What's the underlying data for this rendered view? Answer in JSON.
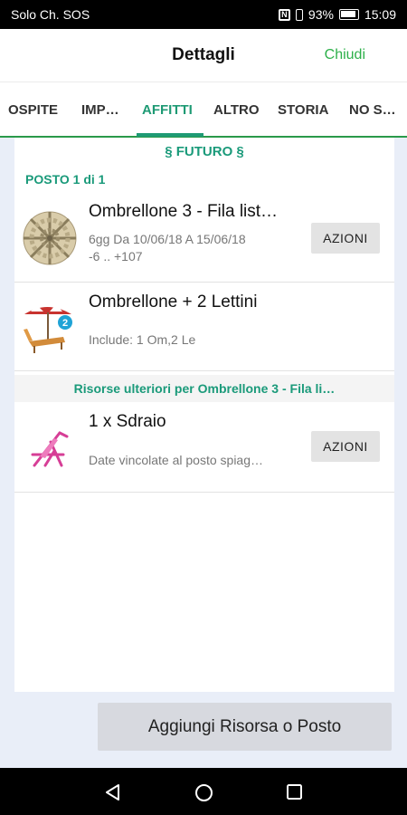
{
  "status_bar": {
    "carrier": "Solo Ch. SOS",
    "battery": "93%",
    "time": "15:09"
  },
  "header": {
    "title": "Dettagli",
    "close_label": "Chiudi"
  },
  "tabs": [
    {
      "label": "OSPITE"
    },
    {
      "label": "IMP…"
    },
    {
      "label": "AFFITTI"
    },
    {
      "label": "ALTRO"
    },
    {
      "label": "STORIA"
    },
    {
      "label": "NO S…"
    }
  ],
  "active_tab": "AFFITTI",
  "main": {
    "section_title": "§  FUTURO  §",
    "posto_label": "POSTO 1 di 1",
    "items": [
      {
        "name": "Ombrellone 3 - Fila list…",
        "details": [
          "6gg  Da 10/06/18 A 15/06/18",
          "-6 .. +107"
        ],
        "action_label": "AZIONI",
        "icon": "umbrella-top-icon"
      },
      {
        "name": "Ombrellone + 2 Lettini",
        "details": [
          "Include: 1 Om,2 Le"
        ],
        "badge": "2",
        "icon": "umbrella-lounger-icon"
      }
    ],
    "resources_header": "Risorse ulteriori per Ombrellone 3 - Fila li…",
    "extra_items": [
      {
        "name": "1 x  Sdraio",
        "details": [
          "Date vincolate al posto spiag…"
        ],
        "action_label": "AZIONI",
        "icon": "deck-chair-icon"
      }
    ]
  },
  "add_button_label": "Aggiungi Risorsa o Posto",
  "nav_bar": [
    "back-icon",
    "home-icon",
    "recents-icon"
  ],
  "colors": {
    "accent": "#1e9a74",
    "close": "#2db04a",
    "background": "#e9eef8"
  }
}
